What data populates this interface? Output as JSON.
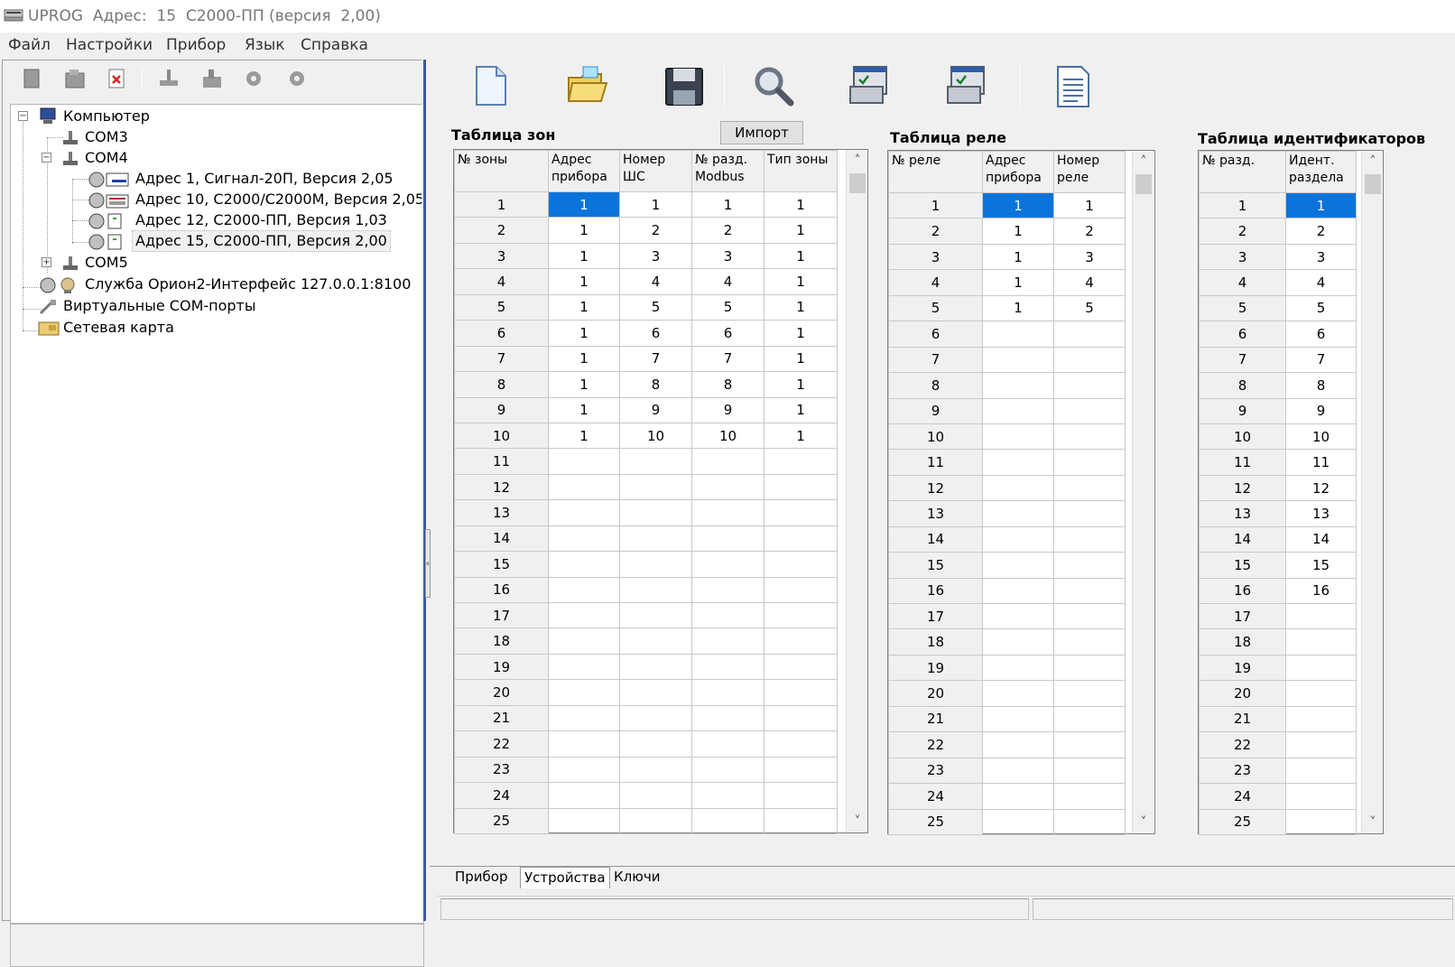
{
  "titlebar": {
    "title": "UPROG  Адрес:  15  С2000-ПП (версия  2,00)"
  },
  "menu": [
    "Файл",
    "Настройки",
    "Прибор",
    "Язык",
    "Справка"
  ],
  "tree": {
    "computer": "Компьютер",
    "com3": "COM3",
    "com4": "COM4",
    "device1": "Адрес 1, Сигнал-20П, Версия 2,05",
    "device10": "Адрес 10, С2000/С2000М, Версия 2,05",
    "device12": "Адрес 12, С2000-ПП, Версия 1,03",
    "device15": "Адрес 15, С2000-ПП, Версия 2,00",
    "com5": "COM5",
    "orion": "Служба Орион2-Интерфейс 127.0.0.1:8100",
    "virtual": "Виртуальные COM-порты",
    "network": "Сетевая карта"
  },
  "zones": {
    "title": "Таблица зон",
    "import_label": "Импорт",
    "headers": [
      "№ зоны",
      "Адрес прибора",
      "Номер ШС",
      "№ разд. Modbus",
      "Тип зоны"
    ],
    "rows": [
      [
        "1",
        "1",
        "1",
        "1",
        "1"
      ],
      [
        "2",
        "1",
        "2",
        "2",
        "1"
      ],
      [
        "3",
        "1",
        "3",
        "3",
        "1"
      ],
      [
        "4",
        "1",
        "4",
        "4",
        "1"
      ],
      [
        "5",
        "1",
        "5",
        "5",
        "1"
      ],
      [
        "6",
        "1",
        "6",
        "6",
        "1"
      ],
      [
        "7",
        "1",
        "7",
        "7",
        "1"
      ],
      [
        "8",
        "1",
        "8",
        "8",
        "1"
      ],
      [
        "9",
        "1",
        "9",
        "9",
        "1"
      ],
      [
        "10",
        "1",
        "10",
        "10",
        "1"
      ],
      [
        "11",
        "",
        "",
        "",
        ""
      ],
      [
        "12",
        "",
        "",
        "",
        ""
      ],
      [
        "13",
        "",
        "",
        "",
        ""
      ],
      [
        "14",
        "",
        "",
        "",
        ""
      ],
      [
        "15",
        "",
        "",
        "",
        ""
      ],
      [
        "16",
        "",
        "",
        "",
        ""
      ],
      [
        "17",
        "",
        "",
        "",
        ""
      ],
      [
        "18",
        "",
        "",
        "",
        ""
      ],
      [
        "19",
        "",
        "",
        "",
        ""
      ],
      [
        "20",
        "",
        "",
        "",
        ""
      ],
      [
        "21",
        "",
        "",
        "",
        ""
      ],
      [
        "22",
        "",
        "",
        "",
        ""
      ],
      [
        "23",
        "",
        "",
        "",
        ""
      ],
      [
        "24",
        "",
        "",
        "",
        ""
      ],
      [
        "25",
        "",
        "",
        "",
        ""
      ]
    ]
  },
  "relays": {
    "title": "Таблица реле",
    "headers": [
      "№ реле",
      "Адрес прибора",
      "Номер реле"
    ],
    "rows": [
      [
        "1",
        "1",
        "1"
      ],
      [
        "2",
        "1",
        "2"
      ],
      [
        "3",
        "1",
        "3"
      ],
      [
        "4",
        "1",
        "4"
      ],
      [
        "5",
        "1",
        "5"
      ],
      [
        "6",
        "",
        ""
      ],
      [
        "7",
        "",
        ""
      ],
      [
        "8",
        "",
        ""
      ],
      [
        "9",
        "",
        ""
      ],
      [
        "10",
        "",
        ""
      ],
      [
        "11",
        "",
        ""
      ],
      [
        "12",
        "",
        ""
      ],
      [
        "13",
        "",
        ""
      ],
      [
        "14",
        "",
        ""
      ],
      [
        "15",
        "",
        ""
      ],
      [
        "16",
        "",
        ""
      ],
      [
        "17",
        "",
        ""
      ],
      [
        "18",
        "",
        ""
      ],
      [
        "19",
        "",
        ""
      ],
      [
        "20",
        "",
        ""
      ],
      [
        "21",
        "",
        ""
      ],
      [
        "22",
        "",
        ""
      ],
      [
        "23",
        "",
        ""
      ],
      [
        "24",
        "",
        ""
      ],
      [
        "25",
        "",
        ""
      ]
    ]
  },
  "ids": {
    "title": "Таблица идентификаторов",
    "headers": [
      "№ разд.",
      "Идент. раздела"
    ],
    "rows": [
      [
        "1",
        "1"
      ],
      [
        "2",
        "2"
      ],
      [
        "3",
        "3"
      ],
      [
        "4",
        "4"
      ],
      [
        "5",
        "5"
      ],
      [
        "6",
        "6"
      ],
      [
        "7",
        "7"
      ],
      [
        "8",
        "8"
      ],
      [
        "9",
        "9"
      ],
      [
        "10",
        "10"
      ],
      [
        "11",
        "11"
      ],
      [
        "12",
        "12"
      ],
      [
        "13",
        "13"
      ],
      [
        "14",
        "14"
      ],
      [
        "15",
        "15"
      ],
      [
        "16",
        "16"
      ],
      [
        "17",
        ""
      ],
      [
        "18",
        ""
      ],
      [
        "19",
        ""
      ],
      [
        "20",
        ""
      ],
      [
        "21",
        ""
      ],
      [
        "22",
        ""
      ],
      [
        "23",
        ""
      ],
      [
        "24",
        ""
      ],
      [
        "25",
        ""
      ]
    ]
  },
  "tabs": [
    "Прибор",
    "Устройства",
    "Ключи"
  ],
  "colors": {
    "selection": "#0a74da",
    "splitter": "#3d5a9e"
  },
  "icons": {
    "small_toolbar": [
      "new-config-icon",
      "open-config-icon",
      "delete-icon",
      "port-icon",
      "read-icon",
      "settings-gear-icon",
      "settings-gear2-icon"
    ],
    "big_toolbar": [
      "new-file-icon",
      "open-folder-icon",
      "save-disk-icon",
      "search-icon",
      "read-config-icon",
      "write-config-icon",
      "report-icon"
    ]
  }
}
